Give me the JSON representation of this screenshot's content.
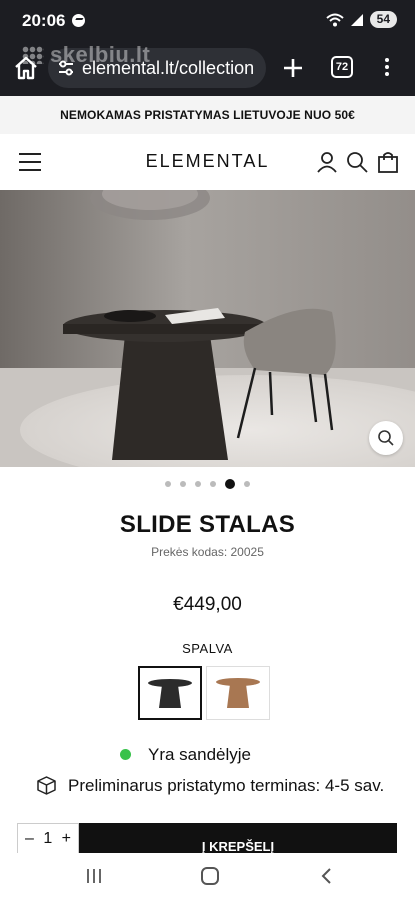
{
  "status_bar": {
    "time": "20:06",
    "battery": "54"
  },
  "browser": {
    "url": "elemental.lt/collection",
    "tab_count": "72",
    "watermark": "skelbiu.lt"
  },
  "promo": {
    "text": "NEMOKAMAS PRISTATYMAS LIETUVOJE NUO 50€"
  },
  "header": {
    "logo": "ELEMENTAL"
  },
  "product": {
    "title": "SLIDE STALAS",
    "code": "Prekės kodas: 20025",
    "price": "€449,00",
    "color_label": "SPALVA",
    "swatches": [
      {
        "name": "dark",
        "color": "#2b2b2b"
      },
      {
        "name": "natural",
        "color": "#a87752"
      }
    ],
    "stock_status": "Yra sandėlyje",
    "delivery": "Preliminarus pristatymo terminas: 4-5 sav."
  },
  "carousel": {
    "total": 6,
    "active_index": 4
  },
  "buy": {
    "quantity": "1",
    "minus": "–",
    "plus": "+",
    "add_to_cart": "Į KREPŠELĮ"
  },
  "colors": {
    "status_green": "#38c24a",
    "chrome": "#1c1d22",
    "button": "#111111"
  },
  "icons": [
    "home-icon",
    "site-settings-icon",
    "plus-icon",
    "tabs-icon",
    "kebab-menu-icon",
    "hamburger-icon",
    "user-icon",
    "search-icon",
    "shopping-bag-icon",
    "zoom-icon",
    "package-icon",
    "recents-icon",
    "home-nav-icon",
    "back-icon"
  ]
}
